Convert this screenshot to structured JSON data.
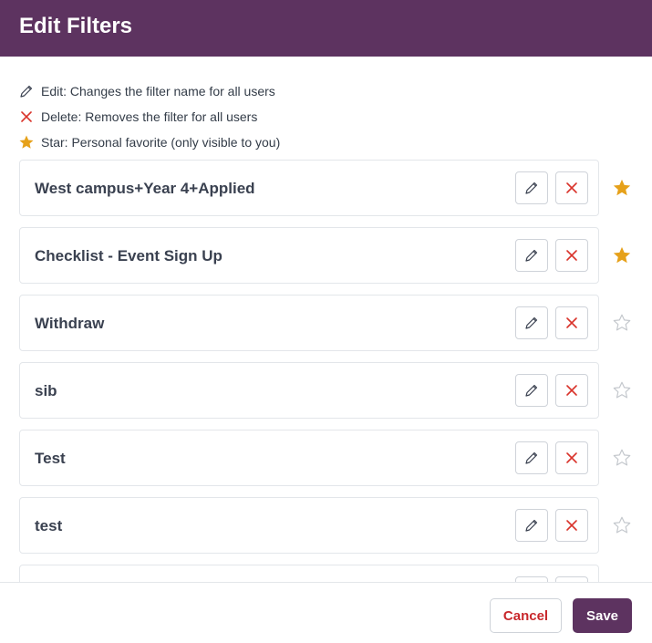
{
  "dialog": {
    "title": "Edit Filters"
  },
  "legend": [
    {
      "icon": "pencil-icon",
      "text": "Edit: Changes the filter name for all users"
    },
    {
      "icon": "x-icon",
      "text": "Delete: Removes the filter for all users"
    },
    {
      "icon": "star-filled-icon",
      "text": "Star: Personal favorite (only visible to you)"
    }
  ],
  "filters": [
    {
      "name": "West campus+Year 4+Applied",
      "starred": true
    },
    {
      "name": "Checklist - Event Sign Up",
      "starred": true
    },
    {
      "name": "Withdraw",
      "starred": false
    },
    {
      "name": "sib",
      "starred": false
    },
    {
      "name": "Test",
      "starred": false
    },
    {
      "name": "test",
      "starred": false
    },
    {
      "name": "",
      "starred": false
    }
  ],
  "footer": {
    "cancel_label": "Cancel",
    "save_label": "Save"
  },
  "colors": {
    "header_bg": "#5d3360",
    "star_on": "#e6a11a",
    "star_off": "#c4c8cd",
    "delete_red": "#d9342b",
    "cancel_text": "#c8282c"
  }
}
